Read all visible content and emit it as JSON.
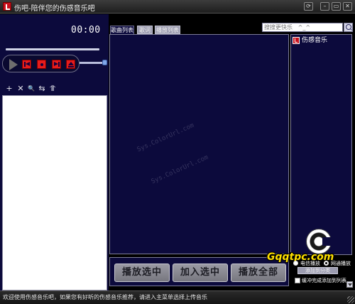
{
  "window": {
    "title": "伤吧-陪伴您的伤感音乐吧",
    "controls": [
      "restore-icon",
      "minimize-icon",
      "close-icon"
    ]
  },
  "player": {
    "time": "00:00",
    "progress": 0,
    "volume": 0.95,
    "buttons": [
      "play-icon",
      "prev-icon",
      "stop-icon",
      "next-icon",
      "eject-icon"
    ]
  },
  "playlist_tools": [
    {
      "icon": "add-icon",
      "glyph": "+"
    },
    {
      "icon": "delete-icon",
      "glyph": "✕"
    },
    {
      "icon": "find-icon",
      "glyph": "🔍"
    },
    {
      "icon": "sort-icon",
      "glyph": "⇆"
    },
    {
      "icon": "queue-icon",
      "glyph": "⥣"
    }
  ],
  "tabs": [
    {
      "label": "歌曲列表",
      "active": true
    },
    {
      "label": "歌词",
      "active": false
    },
    {
      "label": "播放列表",
      "active": false
    }
  ],
  "search": {
    "placeholder": "搜搜更快乐   ^_^"
  },
  "categories": [
    {
      "label": "伤感音乐",
      "icon": "music-icon"
    }
  ],
  "actions": {
    "play_selected": "播放选中",
    "add_selected": "加入选中",
    "play_all": "播放全部"
  },
  "options": {
    "radio_1": "电信播放",
    "radio_2": "网通播放",
    "radio_checked": "radio_2",
    "add_category": "添加到分类",
    "auto_add": "缓冲完成添加到列表"
  },
  "logo": {
    "text": "Gqqtpc.com"
  },
  "status": {
    "text": "欢迎使用伤感音乐吧，如果您有好听的伤感音乐推荐，请进入主菜单选择上传音乐"
  },
  "colors": {
    "panel_bg": "#0c0a3c",
    "accent_red": "#e61c1c",
    "logo_yellow": "#ffe000"
  }
}
